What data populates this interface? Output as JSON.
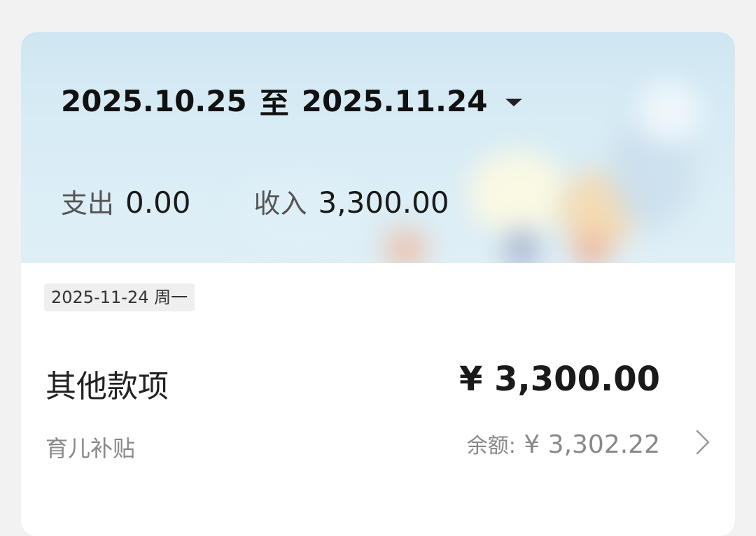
{
  "header": {
    "start_date": "2025.10.25",
    "range_separator": "至",
    "end_date": "2025.11.24"
  },
  "summary": {
    "expense_label": "支出",
    "expense_value": "0.00",
    "income_label": "收入",
    "income_value": "3,300.00"
  },
  "day_group": {
    "date_label": "2025-11-24 周一"
  },
  "transaction": {
    "title": "其他款项",
    "amount": "¥ 3,300.00",
    "note": "育儿补贴",
    "balance_label": "余额:",
    "balance_value": "¥ 3,302.22"
  },
  "icons": {
    "dropdown": "caret-down-icon",
    "detail": "chevron-right-icon"
  },
  "colors": {
    "banner": "#d6eaf4",
    "background": "#f2f2f2",
    "secondary_text": "#888888"
  }
}
